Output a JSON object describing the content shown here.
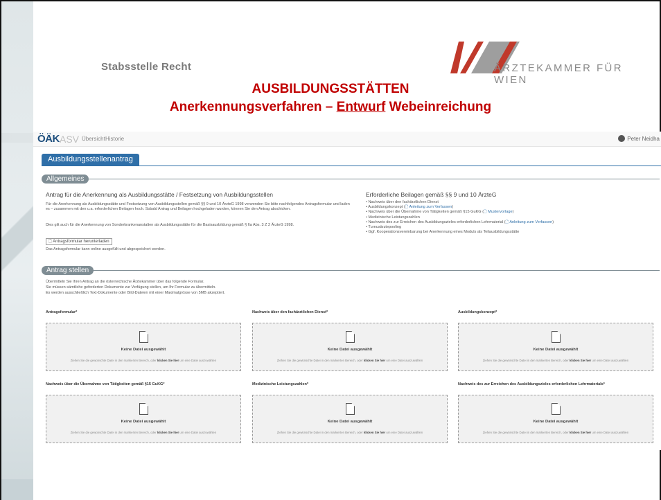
{
  "slide": {
    "org_unit": "Stabsstelle Recht",
    "logo_text": "ÄRZTEKAMMER FÜR WIEN",
    "title_line1": "AUSBILDUNGSSTÄTTEN",
    "title_line2_prefix": "Anerkennungsverfahren – ",
    "title_line2_underlined": "Entwurf",
    "title_line2_suffix": " Webeinreichung",
    "accent_color": "#c00000"
  },
  "app": {
    "brand": "ÖÄK",
    "product": "ASV",
    "nav": [
      "Übersicht",
      "Historie"
    ],
    "user": "Peter Neidha",
    "tab": "Ausbildungsstellenantrag",
    "primary_color": "#2f6fa8"
  },
  "allgemeines": {
    "section_title": "Allgemeines",
    "left_heading": "Antrag für die Anerkennung als Ausbildungsstätte / Festsetzung von Ausbildungsstellen",
    "left_p1": "Für die Anerkennung als Ausbildungsstätte und Festsetzung von Ausbildungsstellen gemäß §§ 9 und 10 ÄrzteG 1998 verwenden Sie bitte nachfolgendes Antragsformular und laden es – zusammen mit den u.a. erforderlichen Beilagen hoch. Sobald Antrag und Beilagen hochgeladen wurden, können Sie den Antrag abschicken.",
    "left_p2": "Dies gilt auch für die Anerkennung von Sonderkrankenanstalten als Ausbildungsstätte für die Basisausbildung gemäß § 6a Abs. 3 Z 2 ÄrzteG 1998.",
    "download_label": "Antragsformular herunterladen",
    "left_p3": "Das Antragsformular kann online ausgefüllt und abgespeichert werden.",
    "right_heading": "Erforderliche Beilagen gemäß §§ 9 und 10 ÄrzteG",
    "bullets": [
      "Nachweis über den fachärztlichen Dienst",
      "Ausbildungskonzept (",
      "Nachweis über die Übernahme von Tätigkeiten gemäß §15 GuKG (",
      "Medizinische Leistungszahlen",
      "Nachweis des zur Erreichen des Ausbildungszieles erforderlichen Lehrmaterial (",
      "Turnusärztepooling",
      "Ggf. Kooperationsvereinbarung bei Anerkennung eines Moduls als Teilausbildungsstätte"
    ],
    "link_anleitung": "Anleitung zum Verfassen",
    "link_mustervorlage": "Mustervorlage",
    "closing_paren": ")"
  },
  "antrag": {
    "section_title": "Antrag stellen",
    "intro1": "Übermitteln Sie Ihren Antrag an die österreichische Ärztekammer über das folgende Formular.",
    "intro2": "Sie müssen sämtliche geforderten Dokumente zur Verfügung stellen, um Ihr Formular zu übermitteln.",
    "intro3": "Es werden ausschließlich Text-Dokumente oder Bild-Dateien mit einer Maximalgrösse von 5MB akzeptiert.",
    "dz_title": "Keine Datei ausgewählt",
    "dz_hint_pre": "Ziehen Sie die gewünschte Datei in den markierten Bereich, oder ",
    "dz_hint_bold": "klicken Sie hier",
    "dz_hint_post": " um eine Datei auszuwählen",
    "fields": [
      "Antragsformular*",
      "Nachweis über den fachärztlichen Dienst*",
      "Ausbildungskonzept*",
      "Nachweis über die Übernahme von Tätigkeiten gemäß §15 GuKG*",
      "Medizinische Leistungszahlen*",
      "Nachweis des zur Erreichen des Ausbildungszieles erforderlichen Lehrmaterials*"
    ]
  }
}
